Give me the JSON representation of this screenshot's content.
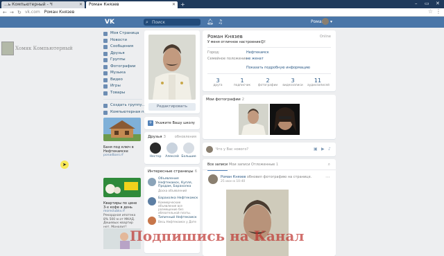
{
  "browser": {
    "tabs": [
      {
        "label": "...ь Компьютерный - Ч"
      },
      {
        "label": "Роман Князев"
      }
    ],
    "new_tab": "+",
    "url_domain": "vk.com",
    "url_title": "Роман Князев"
  },
  "vk_header": {
    "logo": "VK",
    "search_placeholder": "Поиск",
    "user_name": "Роман"
  },
  "watermark": {
    "text": "Хомяк Компьютерный"
  },
  "left_menu": {
    "items": [
      {
        "label": "Моя Страница"
      },
      {
        "label": "Новости"
      },
      {
        "label": "Сообщения"
      },
      {
        "label": "Друзья"
      },
      {
        "label": "Группы"
      },
      {
        "label": "Фотографии"
      },
      {
        "label": "Музыка"
      },
      {
        "label": "Видео"
      },
      {
        "label": "Игры"
      },
      {
        "label": "Товары"
      }
    ],
    "extra": [
      {
        "label": "Создать группу..."
      },
      {
        "label": "Компьютерная по..."
      }
    ]
  },
  "ads": [
    {
      "title": "Баня под ключ в Нефтекамске",
      "link": "ponadbani.rf",
      "text": ""
    },
    {
      "title": "Квартиры по цене 3-х кофе в день",
      "link": "moreclubkv.rf",
      "text": "Рекордная ипотека 8% 500 м от МКАД. Дешевых квартир нет. Монолит!"
    }
  ],
  "profile": {
    "name": "Роман Князев",
    "online": "Online",
    "status": "У меня отличное настроение😊!",
    "edit_button": "Редактировать",
    "info": {
      "city_label": "Город:",
      "city_value": "Нефтекамск",
      "family_label": "Семейное положение:",
      "family_value": "не женат",
      "show_more": "Показать подробную информацию"
    },
    "counters": [
      {
        "num": "3",
        "label": "друга"
      },
      {
        "num": "1",
        "label": "подписчик"
      },
      {
        "num": "2",
        "label": "фотографии"
      },
      {
        "num": "3",
        "label": "видеозаписи"
      },
      {
        "num": "11",
        "label": "аудиозаписей"
      }
    ]
  },
  "school": {
    "text": "Укажите Вашу школу"
  },
  "friends": {
    "title": "Друзья",
    "count": "3",
    "updates": "обновления",
    "list": [
      {
        "name": "Нестор"
      },
      {
        "name": "Алексей"
      },
      {
        "name": "Большие"
      }
    ]
  },
  "pages": {
    "title": "Интересные страницы",
    "count": "6",
    "list": [
      {
        "name": "Объявления Нефтекамск, Купля, Продам, Барахолка",
        "desc": "Доска объявлений"
      },
      {
        "name": "Барахолка Нефтекамск",
        "desc": "Коммерческие объявления все размещение без обязательной платы."
      },
      {
        "name": "Типичный Нефтекамск",
        "desc": "Весь Нефтекамск у Дате"
      }
    ]
  },
  "photos": {
    "title": "Мои фотографии",
    "count": "2"
  },
  "post_new": {
    "placeholder": "Что у Вас нового?"
  },
  "wall": {
    "tabs": [
      {
        "label": "Все записи",
        "count": ""
      },
      {
        "label": "Мои записи",
        "count": ""
      },
      {
        "label": "Отложенные",
        "count": "1"
      }
    ],
    "post": {
      "author": "Роман Князев",
      "action": "обновил фотографию на странице.",
      "date": "25 июн в 10:40"
    }
  },
  "overlay": {
    "text": "Подпишись на Канал"
  }
}
